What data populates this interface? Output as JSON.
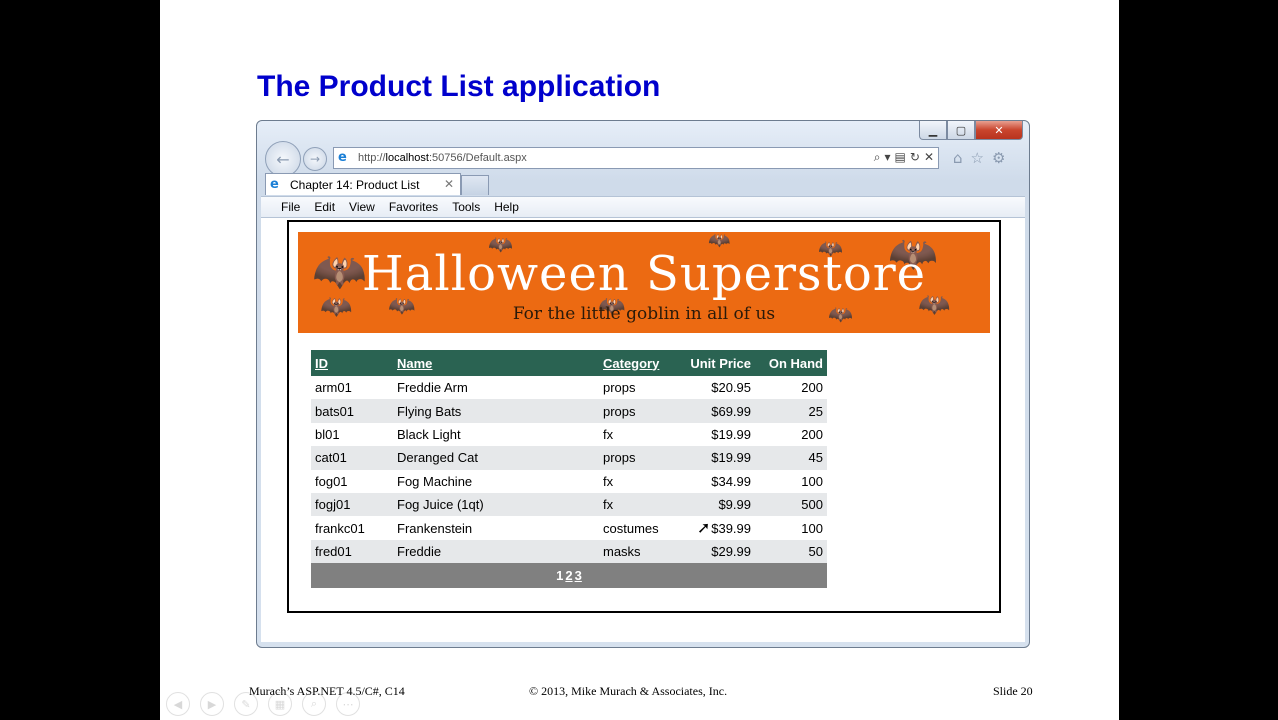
{
  "slide": {
    "title": "The Product List application",
    "footer_left": "Murach’s ASP.NET 4.5/C#, C14",
    "footer_center": "© 2013, Mike Murach & Associates, Inc.",
    "footer_right": "Slide 20"
  },
  "browser": {
    "address_prefix": "http://",
    "address_host": "localhost",
    "address_rest": ":50756/Default.aspx",
    "tab_title": "Chapter 14: Product List",
    "menu": [
      "File",
      "Edit",
      "View",
      "Favorites",
      "Tools",
      "Help"
    ]
  },
  "banner": {
    "title": "Halloween Superstore",
    "subtitle": "For the little goblin in all of us"
  },
  "grid": {
    "headers": [
      "ID",
      "Name",
      "Category",
      "Unit Price",
      "On Hand"
    ],
    "rows": [
      [
        "arm01",
        "Freddie Arm",
        "props",
        "$20.95",
        "200"
      ],
      [
        "bats01",
        "Flying Bats",
        "props",
        "$69.99",
        "25"
      ],
      [
        "bl01",
        "Black Light",
        "fx",
        "$19.99",
        "200"
      ],
      [
        "cat01",
        "Deranged Cat",
        "props",
        "$19.99",
        "45"
      ],
      [
        "fog01",
        "Fog Machine",
        "fx",
        "$34.99",
        "100"
      ],
      [
        "fogj01",
        "Fog Juice (1qt)",
        "fx",
        "$9.99",
        "500"
      ],
      [
        "frankc01",
        "Frankenstein",
        "costumes",
        "$39.99",
        "100"
      ],
      [
        "fred01",
        "Freddie",
        "masks",
        "$29.99",
        "50"
      ]
    ],
    "pager": [
      "1",
      "2",
      "3"
    ]
  },
  "icons": {
    "back": "back-arrow-icon",
    "forward": "forward-arrow-icon",
    "ie": "ie-logo-icon",
    "search": "search-icon",
    "refresh": "refresh-icon",
    "stop": "stop-icon",
    "home": "home-icon",
    "favorites": "star-icon",
    "tools": "gear-icon"
  },
  "colors": {
    "title": "#0000cc",
    "grid_header": "#2a6352",
    "banner": "#ec6a12",
    "pager": "#808080"
  }
}
